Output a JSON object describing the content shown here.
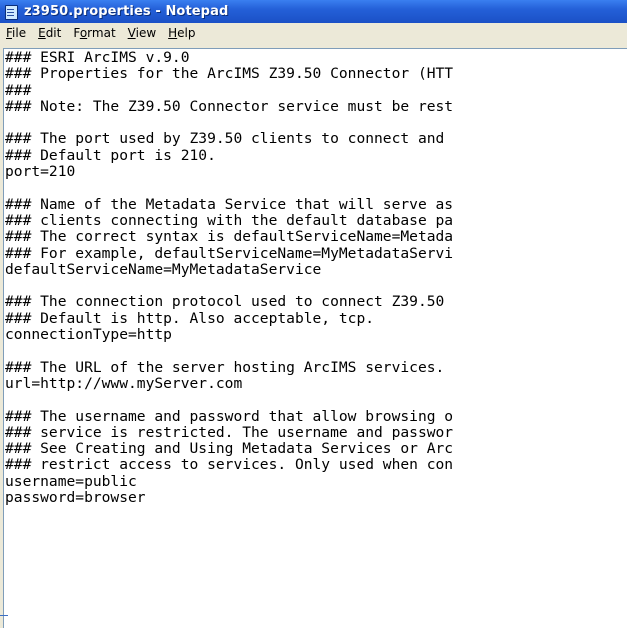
{
  "window": {
    "title": "z3950.properties - Notepad"
  },
  "menu": [
    {
      "accel": "F",
      "rest": "ile"
    },
    {
      "accel": "E",
      "rest": "dit"
    },
    {
      "pre": "F",
      "accel": "o",
      "rest": "rmat"
    },
    {
      "accel": "V",
      "rest": "iew"
    },
    {
      "accel": "H",
      "rest": "elp"
    }
  ],
  "document": {
    "lines": [
      "### ESRI ArcIMS v.9.0",
      "### Properties for the ArcIMS Z39.50 Connector (HTT",
      "###",
      "### Note: The Z39.50 Connector service must be rest",
      "",
      "### The port used by Z39.50 clients to connect and",
      "### Default port is 210.",
      "port=210",
      "",
      "### Name of the Metadata Service that will serve as",
      "### clients connecting with the default database pa",
      "### The correct syntax is defaultServiceName=Metada",
      "### For example, defaultServiceName=MyMetadataServi",
      "defaultServiceName=MyMetadataService",
      "",
      "### The connection protocol used to connect Z39.50",
      "### Default is http. Also acceptable, tcp.",
      "connectionType=http",
      "",
      "### The URL of the server hosting ArcIMS services.",
      "url=http://www.myServer.com",
      "",
      "### The username and password that allow browsing o",
      "### service is restricted. The username and passwor",
      "### See Creating and Using Metadata Services or Arc",
      "### restrict access to services. Only used when con",
      "username=public",
      "password=browser"
    ]
  }
}
